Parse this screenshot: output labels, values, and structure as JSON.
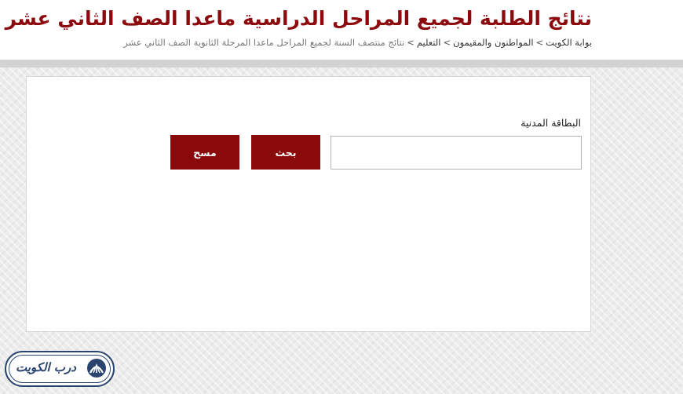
{
  "header": {
    "title": "نتائج الطلبة لجميع المراحل الدراسية ماعدا الصف الثاني عشر",
    "breadcrumb": {
      "items": [
        "بوابة الكويت",
        "المواطنون والمقيمون",
        "التعليم"
      ],
      "current": "نتائج منتصف السنة لجميع المراحل ماعدا المرحلة الثانوية الصف الثاني عشر",
      "separator": ">"
    }
  },
  "form": {
    "civil_id_label": "البطاقة المدنية",
    "civil_id_value": "",
    "search_label": "بحث",
    "clear_label": "مسح"
  },
  "watermark": {
    "text": "درب الكويت",
    "emblem_icon": "road-emblem-icon"
  },
  "colors": {
    "accent": "#8c0a0e",
    "button": "#8a0a0c",
    "logo": "#2a4470",
    "header_bar": "#d2d2d2"
  }
}
